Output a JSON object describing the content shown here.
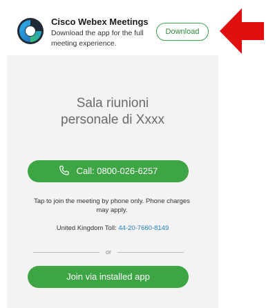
{
  "banner": {
    "app_name": "Cisco Webex Meetings",
    "subtitle_line1": "Download the app for the full",
    "subtitle_line2": "meeting experience.",
    "download_label": "Download",
    "icon": "webex-logo-icon"
  },
  "annotation": {
    "icon": "red-arrow-icon",
    "color": "#e01010"
  },
  "meeting": {
    "room_title_line1": "Sala riunioni",
    "room_title_line2": "personale di Xxxx",
    "call_label": "Call: 0800-026-6257",
    "call_icon": "phone-icon",
    "note_line1": "Tap to join the meeting by phone only. Phone charges",
    "note_line2": "may apply.",
    "toll_label": "United Kingdom Toll:",
    "toll_number": "44-20-7660-8149",
    "divider_text": "or",
    "join_label": "Join via installed app"
  },
  "colors": {
    "accent_green": "#3da544",
    "link_blue": "#1f7fbf",
    "panel_bg": "#f3f3f3"
  }
}
